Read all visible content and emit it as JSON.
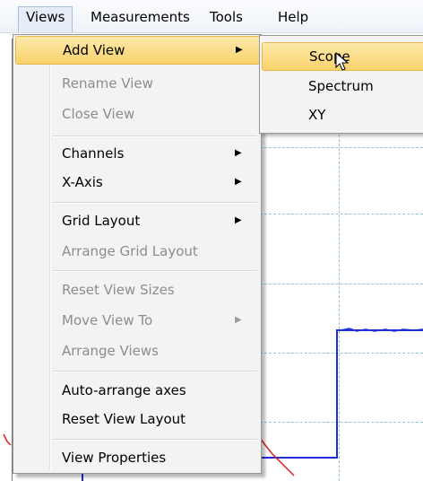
{
  "menubar": {
    "items": [
      {
        "label": "Views"
      },
      {
        "label": "Measurements"
      },
      {
        "label": "Tools"
      },
      {
        "label": "Help"
      }
    ]
  },
  "views_menu": {
    "items": [
      {
        "label": "Add View",
        "enabled": true,
        "submenu": true,
        "highlighted": true
      },
      {
        "label": "Rename View",
        "enabled": false
      },
      {
        "label": "Close View",
        "enabled": false
      },
      {
        "label": "Channels",
        "enabled": true,
        "submenu": true
      },
      {
        "label": "X-Axis",
        "enabled": true,
        "submenu": true
      },
      {
        "label": "Grid Layout",
        "enabled": true,
        "submenu": true
      },
      {
        "label": "Arrange Grid Layout",
        "enabled": false
      },
      {
        "label": "Reset View Sizes",
        "enabled": false
      },
      {
        "label": "Move View To",
        "enabled": false,
        "submenu": true
      },
      {
        "label": "Arrange Views",
        "enabled": false
      },
      {
        "label": "Auto-arrange axes",
        "enabled": true
      },
      {
        "label": "Reset View Layout",
        "enabled": true
      },
      {
        "label": "View Properties",
        "enabled": true
      }
    ]
  },
  "add_view_submenu": {
    "items": [
      {
        "label": "Scope",
        "highlighted": true
      },
      {
        "label": "Spectrum"
      },
      {
        "label": "XY"
      }
    ]
  },
  "colors": {
    "highlight": "#f8d26c",
    "signal_blue": "#1f2fd8",
    "signal_red": "#e02020",
    "grid": "#8fc3e0"
  }
}
